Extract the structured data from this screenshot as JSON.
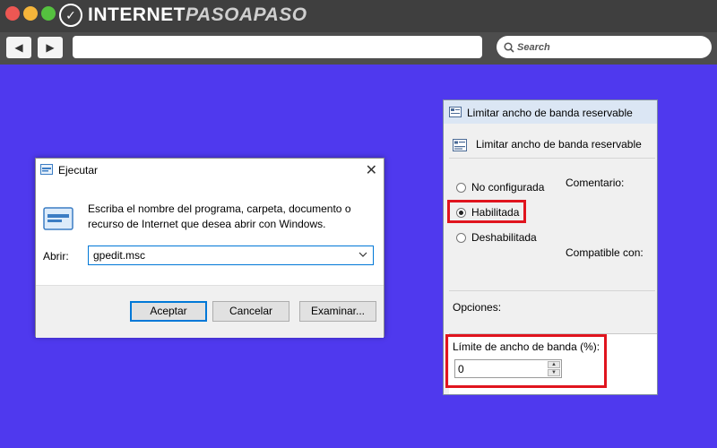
{
  "browser": {
    "brand_prefix": "INTERNET",
    "brand_accent": "PASOAPASO",
    "search_placeholder": "Search",
    "back_glyph": "◀",
    "forward_glyph": "▶"
  },
  "run_dialog": {
    "title": "Ejecutar",
    "close_glyph": "✕",
    "description": "Escriba el nombre del programa, carpeta, documento o recurso de Internet que desea abrir con Windows.",
    "open_label": "Abrir:",
    "input_value": "gpedit.msc",
    "ok_label": "Aceptar",
    "cancel_label": "Cancelar",
    "browse_label": "Examinar..."
  },
  "policy_dialog": {
    "title": "Limitar ancho de banda reservable",
    "heading": "Limitar ancho de banda reservable",
    "radio_not_configured": "No configurada",
    "radio_enabled": "Habilitada",
    "radio_disabled": "Deshabilitada",
    "selected": "Habilitada",
    "comment_label": "Comentario:",
    "compatible_label": "Compatible con:",
    "options_label": "Opciones:",
    "field_label": "Límite de ancho de banda (%):",
    "field_value": "0"
  },
  "colors": {
    "background": "#4f39ee",
    "highlight": "#e0141e",
    "focus": "#0078d7"
  },
  "icons": [
    "search-icon",
    "run-icon",
    "policy-icon",
    "close-icon",
    "chevron-down-icon"
  ]
}
